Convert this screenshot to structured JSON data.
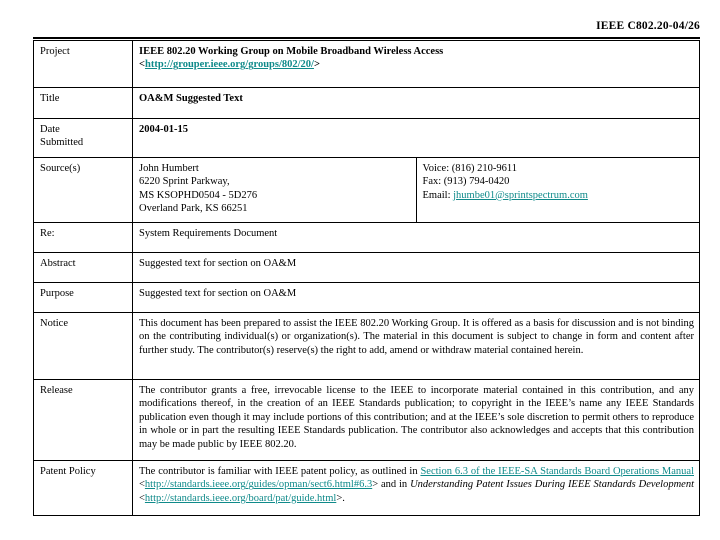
{
  "document": {
    "header_id": "IEEE C802.20-04/26"
  },
  "rows": {
    "project": {
      "label": "Project",
      "value": "IEEE 802.20 Working Group on Mobile Broadband Wireless Access",
      "url_open": "<",
      "url": "http://grouper.ieee.org/groups/802/20/",
      "url_close": ">"
    },
    "title": {
      "label": "Title",
      "value": "OA&M Suggested Text"
    },
    "date_submitted": {
      "label_line1": "Date",
      "label_line2": "Submitted",
      "value": "2004-01-15"
    },
    "sources": {
      "label": "Source(s)",
      "name": "John Humbert",
      "address_line1": "6220 Sprint Parkway,",
      "address_line2": "MS KSOPHD0504 - 5D276",
      "address_line3": "Overland Park, KS 66251",
      "voice": "Voice: (816) 210-9611",
      "fax": "Fax: (913) 794-0420",
      "email_label": "Email: ",
      "email": "jhumbe01@sprintspectrum.com"
    },
    "re": {
      "label": "Re:",
      "value": "System Requirements Document"
    },
    "abstract": {
      "label": "Abstract",
      "value": "Suggested text for section on OA&M"
    },
    "purpose": {
      "label": "Purpose",
      "value": "Suggested text for section on OA&M"
    },
    "notice": {
      "label": "Notice",
      "value": "This document has been prepared to assist the IEEE 802.20 Working Group. It is offered as a basis for discussion and is not binding on the contributing individual(s) or organization(s). The material in this document is subject to change in form and content after further study. The contributor(s) reserve(s) the right to add, amend or withdraw material contained herein."
    },
    "release": {
      "label": "Release",
      "value": "The contributor grants a free, irrevocable license to the IEEE to incorporate material contained in this contribution, and any modifications thereof, in the creation of an IEEE Standards publication; to copyright in the IEEE’s name any IEEE Standards publication even though it may include portions of this contribution; and at the IEEE’s sole discretion to permit others to reproduce in whole or in part the resulting IEEE Standards publication. The contributor also acknowledges and accepts that this contribution may be made public by IEEE 802.20."
    },
    "patent_policy": {
      "label": "Patent Policy",
      "text_before": "The contributor is familiar with IEEE patent policy, as outlined in ",
      "link_section": "Section 6.3 of the IEEE-SA Standards Board Operations Manual",
      "url1_open": "<",
      "url1": "http://standards.ieee.org/guides/opman/sect6.html#6.3",
      "url1_close": ">",
      "text_middle": " and in ",
      "italic_title": "Understanding Patent Issues During IEEE Standards Development",
      "url2_open": "<",
      "url2": "http://standards.ieee.org/board/pat/guide.html",
      "url2_close": ">."
    }
  },
  "colors": {
    "link": "#0f8a8a",
    "text": "#000000",
    "background": "#ffffff"
  }
}
